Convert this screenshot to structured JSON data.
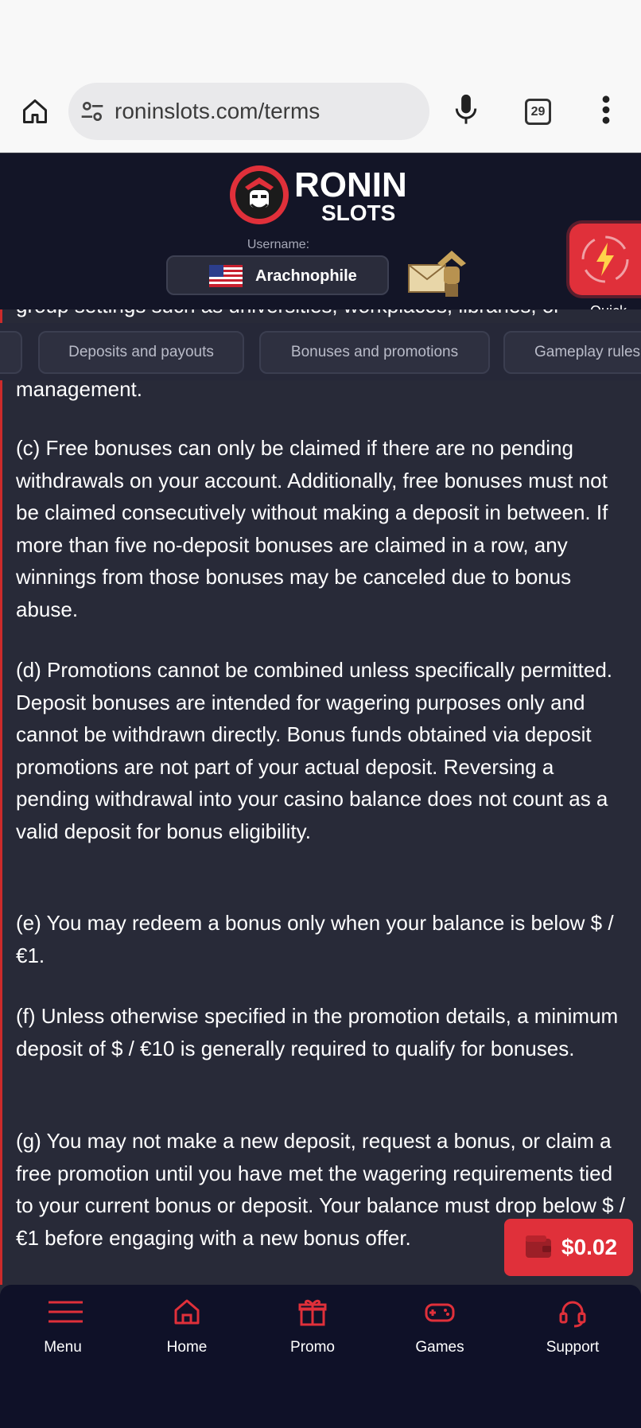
{
  "browser": {
    "url": "roninslots.com/terms",
    "tab_count": "29"
  },
  "header": {
    "brand_top": "RONIN",
    "brand_bottom": "SLOTS",
    "username_label": "Username:",
    "username": "Arachnophile",
    "quick_deposit_label": "Quick Deposit"
  },
  "category_tabs": [
    {
      "label": ""
    },
    {
      "label": "Deposits and payouts"
    },
    {
      "label": "Bonuses and promotions"
    },
    {
      "label": "Gameplay rules"
    }
  ],
  "terms": {
    "clipped_top_line": "group settings such as universities, workplaces, libraries, or",
    "partial_line": "management.",
    "c": "(c) Free bonuses can only be claimed if there are no pending withdrawals on your account. Additionally, free bonuses must not be claimed consecutively without making a deposit in between. If more than five no-deposit bonuses are claimed in a row, any winnings from those bonuses may be canceled due to bonus abuse.",
    "d": "(d) Promotions cannot be combined unless specifically permitted. Deposit bonuses are intended for wagering purposes only and cannot be withdrawn directly. Bonus funds obtained via deposit promotions are not part of your actual deposit. Reversing a pending withdrawal into your casino balance does not count as a valid deposit for bonus eligibility.",
    "e": "(e) You may redeem a bonus only when your balance is below $ / €1.",
    "f": "(f) Unless otherwise specified in the promotion details, a minimum deposit of $ / €10 is generally required to qualify for bonuses.",
    "g": "(g) You may not make a new deposit, request a bonus, or claim a free promotion until you have met the wagering requirements tied to your current bonus or deposit. Your balance must drop below $ / €1 before engaging with a new bonus offer."
  },
  "balance": {
    "amount": "$0.02"
  },
  "bottom_nav": [
    {
      "label": "Menu",
      "icon": "hamburger-icon"
    },
    {
      "label": "Home",
      "icon": "home-icon"
    },
    {
      "label": "Promo",
      "icon": "gift-icon"
    },
    {
      "label": "Games",
      "icon": "gamepad-icon"
    },
    {
      "label": "Support",
      "icon": "headset-icon"
    }
  ],
  "colors": {
    "accent_red": "#e0303a",
    "header_bg": "#131527",
    "content_bg": "#282a38",
    "nav_bg": "#0f1128"
  }
}
